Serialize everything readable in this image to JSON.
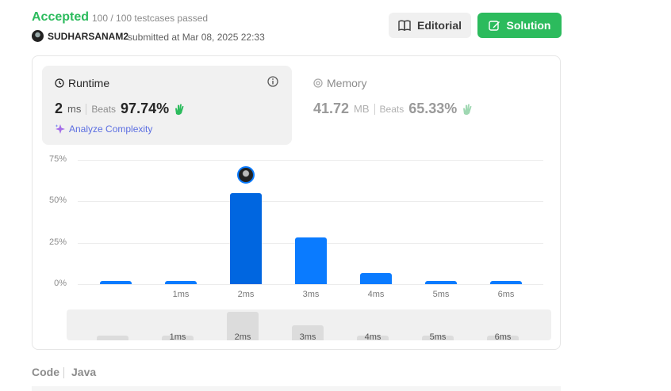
{
  "submission": {
    "status": "Accepted",
    "testcases": "100 / 100 testcases passed",
    "user": "SUDHARSANAM2",
    "submitted_text": "submitted at Mar 08, 2025 22:33",
    "status_color": "#2cbb5d"
  },
  "toolbar": {
    "editorial_label": "Editorial",
    "solution_label": "Solution"
  },
  "runtime": {
    "title": "Runtime",
    "value": "2",
    "unit": "ms",
    "beats_label": "Beats",
    "beats_value": "97.74%",
    "analyze_label": "Analyze Complexity"
  },
  "memory": {
    "title": "Memory",
    "value": "41.72",
    "unit": "MB",
    "beats_label": "Beats",
    "beats_value": "65.33%"
  },
  "chart_data": {
    "type": "bar",
    "categories": [
      "",
      "1ms",
      "2ms",
      "3ms",
      "4ms",
      "5ms",
      "6ms"
    ],
    "values": [
      1.5,
      1.5,
      55,
      28,
      6.5,
      1.5,
      1.5
    ],
    "yticks": [
      "75%",
      "50%",
      "25%",
      "0%"
    ],
    "ylim": [
      0,
      75
    ],
    "highlight_index": 2,
    "bar_color": "#0a7bff",
    "grid": true
  },
  "minimap": {
    "labels": [
      "",
      "1ms",
      "2ms",
      "3ms",
      "4ms",
      "5ms",
      "6ms"
    ]
  },
  "code": {
    "label": "Code",
    "language": "Java"
  }
}
